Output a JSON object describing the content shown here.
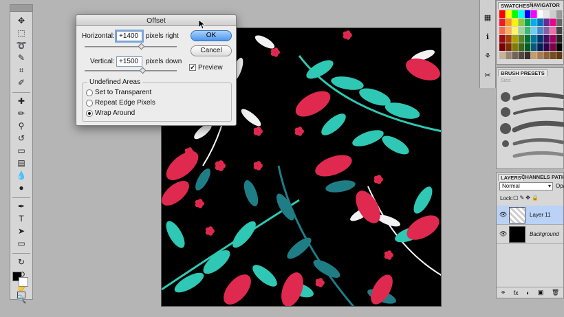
{
  "dialog": {
    "title": "Offset",
    "horizontal_label": "Horizontal:",
    "horizontal_value": "+1400",
    "horizontal_unit": "pixels right",
    "vertical_label": "Vertical:",
    "vertical_value": "+1500",
    "vertical_unit": "pixels down",
    "ok_label": "OK",
    "cancel_label": "Cancel",
    "preview_label": "Preview",
    "preview_checked": true,
    "undefined_areas_label": "Undefined Areas",
    "options": [
      "Set to Transparent",
      "Repeat Edge Pixels",
      "Wrap Around"
    ],
    "selected_option": "Wrap Around"
  },
  "panels": {
    "swatches_tab": "SWATCHES",
    "navigator_tab": "NAVIGATOR",
    "brush_presets_tab": "BRUSH PRESETS",
    "size_label": "Size:",
    "layers_tab": "LAYERS",
    "channels_tab": "CHANNELS",
    "paths_tab": "PATH",
    "blend_mode": "Normal",
    "opacity_label": "Opa",
    "lock_label": "Lock:",
    "layers": [
      {
        "name": "Layer 11",
        "selected": true
      },
      {
        "name": "Background",
        "selected": false
      }
    ]
  },
  "tools": [
    "move-tool",
    "marquee-tool",
    "lasso-tool",
    "quick-select-tool",
    "crop-tool",
    "eyedropper-tool",
    "spot-heal-tool",
    "brush-tool",
    "clone-stamp-tool",
    "history-brush-tool",
    "eraser-tool",
    "gradient-tool",
    "blur-tool",
    "dodge-tool",
    "pen-tool",
    "type-tool",
    "path-select-tool",
    "shape-tool",
    "3d-rotate-tool",
    "3d-orbit-tool",
    "hand-tool",
    "zoom-tool"
  ],
  "colors": {
    "accent": "#4d97ef",
    "leaf_teal": "#2fc8b4",
    "leaf_dark_teal": "#1f7d86",
    "leaf_red": "#e0294f",
    "canvas_bg": "#000000"
  }
}
